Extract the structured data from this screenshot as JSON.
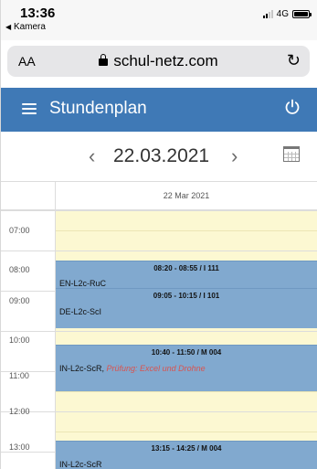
{
  "status_bar": {
    "time": "13:36",
    "back_app": "Kamera",
    "network": "4G"
  },
  "browser": {
    "text_size": "AA",
    "url": "schul-netz.com"
  },
  "header": {
    "title": "Stundenplan"
  },
  "date_nav": {
    "date": "22.03.2021"
  },
  "schedule": {
    "day_header": "22 Mar 2021",
    "hours": [
      "07:00",
      "08:00",
      "09:00",
      "10:00",
      "11:00",
      "12:00",
      "13:00"
    ],
    "events": [
      {
        "time_room": "08:20 - 08:55 / I 111",
        "course": "EN-L2c-RuC",
        "note": ""
      },
      {
        "time_room": "09:05 - 10:15 / I 101",
        "course": "DE-L2c-ScI",
        "note": ""
      },
      {
        "time_room": "10:40 - 11:50 / M 004",
        "course": "IN-L2c-ScR,",
        "note": "Prüfung: Excel und Drohne"
      },
      {
        "time_room": "13:15 - 14:25 / M 004",
        "course": "IN-L2c-ScR",
        "note": ""
      }
    ]
  },
  "colors": {
    "header_bg": "#3f79b6",
    "event_bg": "#81a9cf",
    "day_bg": "#fcf8d2",
    "exam_text": "#d9534f"
  },
  "icons": {
    "menu": "hamburger-icon",
    "logout": "power-icon",
    "calendar": "calendar-icon",
    "prev": "chevron-left-icon",
    "next": "chevron-right-icon",
    "reload": "reload-icon",
    "lock": "lock-icon"
  }
}
